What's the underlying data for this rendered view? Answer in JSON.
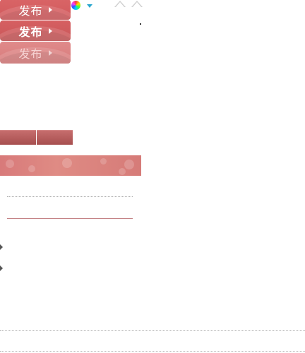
{
  "publish_buttons": {
    "label": "发布"
  },
  "icons": {
    "color": "color-wheel-icon",
    "dropdown": "chevron-down-icon",
    "up": "chevron-up-icon",
    "bullet": "chevron-right-icon"
  },
  "colors": {
    "accent": "#d15a5d",
    "accent_light": "#e08a8a",
    "tab": "#b35c5c",
    "banner": "#df8b84",
    "separator": "#c48386"
  }
}
